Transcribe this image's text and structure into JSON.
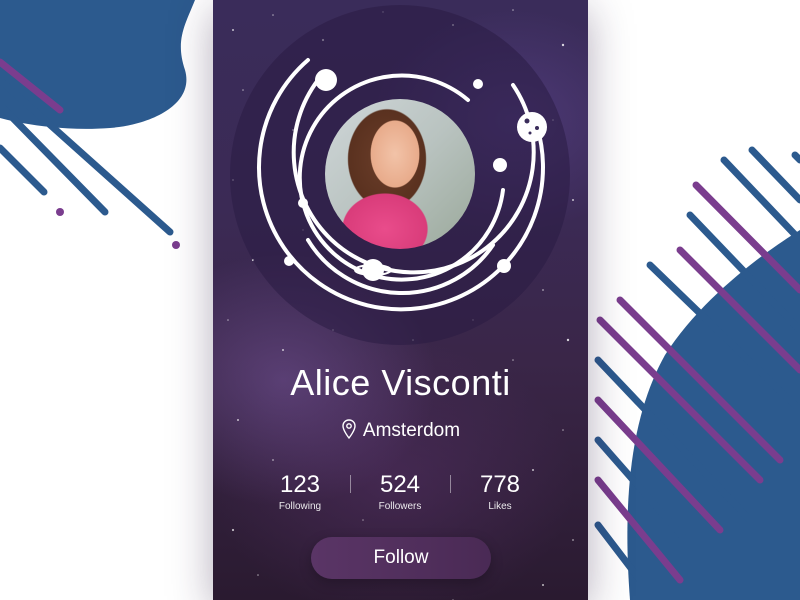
{
  "profile": {
    "name": "Alice Visconti",
    "location": "Amsterdom"
  },
  "stats": [
    {
      "value": "123",
      "label": "Following"
    },
    {
      "value": "524",
      "label": "Followers"
    },
    {
      "value": "778",
      "label": "Likes"
    }
  ],
  "actions": {
    "follow_label": "Follow"
  },
  "icons": {
    "location": "location-pin-icon"
  },
  "colors": {
    "blue_blob": "#2c5a8e",
    "purple_stripe": "#7a3d8e",
    "card_bg": "#3a2c5a",
    "button_bg": "#5a3566"
  }
}
